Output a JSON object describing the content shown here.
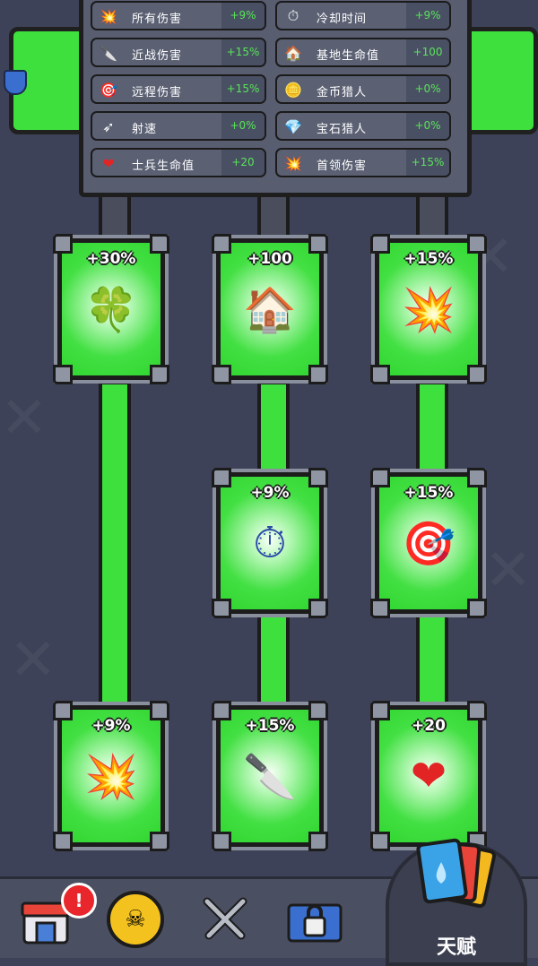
{
  "stats": [
    {
      "icon": "explosion-icon",
      "label": "所有伤害",
      "value": "+9%"
    },
    {
      "icon": "soldier-clock-icon",
      "label": "冷却时间",
      "value": "+9%"
    },
    {
      "icon": "knife-icon",
      "label": "近战伤害",
      "value": "+15%"
    },
    {
      "icon": "base-heart-icon",
      "label": "基地生命值",
      "value": "+100"
    },
    {
      "icon": "target-icon",
      "label": "远程伤害",
      "value": "+15%"
    },
    {
      "icon": "gold-coin-icon",
      "label": "金币猎人",
      "value": "+0%"
    },
    {
      "icon": "bullets-icon",
      "label": "射速",
      "value": "+0%"
    },
    {
      "icon": "gem-skull-icon",
      "label": "宝石猎人",
      "value": "+0%"
    },
    {
      "icon": "heart-icon",
      "label": "士兵生命值",
      "value": "+20"
    },
    {
      "icon": "tank-explosion-icon",
      "label": "首领伤害",
      "value": "+15%"
    }
  ],
  "cards": [
    {
      "value": "+30%",
      "icon": "clover-icon",
      "glyph": "🍀"
    },
    {
      "value": "+100",
      "icon": "base-heart-icon",
      "glyph": "🏠"
    },
    {
      "value": "+15%",
      "icon": "tank-explosion-icon",
      "glyph": "💥"
    },
    {
      "value": "+9%",
      "icon": "soldier-clock-icon",
      "glyph": "⏱"
    },
    {
      "value": "+15%",
      "icon": "target-icon",
      "glyph": "🎯"
    },
    {
      "value": "+9%",
      "icon": "explosion-icon",
      "glyph": "💥"
    },
    {
      "value": "+15%",
      "icon": "knife-icon",
      "glyph": "🔪"
    },
    {
      "value": "+20",
      "icon": "heart-icon",
      "glyph": "❤"
    }
  ],
  "nav": {
    "shop_badge": "!",
    "talent_label": "天赋"
  },
  "colors": {
    "accent_green": "#3de03d",
    "value_green": "#58e458",
    "badge_red": "#e8262c"
  }
}
